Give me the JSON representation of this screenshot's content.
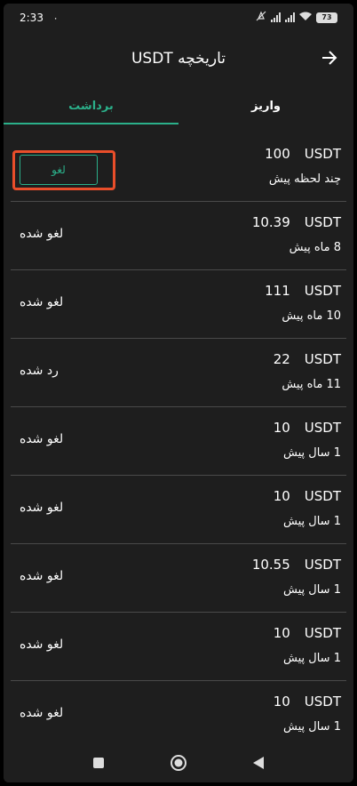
{
  "status_bar": {
    "time": "2:33",
    "small_icon": "vibrate-icon",
    "battery": "73"
  },
  "header": {
    "title": "تاریخچه  USDT",
    "back_icon": "arrow-right-icon"
  },
  "tabs": [
    {
      "label": "واریز",
      "active": false
    },
    {
      "label": "برداشت",
      "active": true
    }
  ],
  "colors": {
    "accent": "#2bb08a",
    "highlight": "#e94e2a",
    "background": "#1e1e1e",
    "divider": "#4a4a4a"
  },
  "rows": [
    {
      "value": "100",
      "currency": "USDT",
      "time": "چند لحظه پیش",
      "action_label": "لغو"
    },
    {
      "value": "10.39",
      "currency": "USDT",
      "time": "8 ماه پیش",
      "status": "لغو شده"
    },
    {
      "value": "111",
      "currency": "USDT",
      "time": "10 ماه پیش",
      "status": "لغو شده"
    },
    {
      "value": "22",
      "currency": "USDT",
      "time": "11 ماه پیش",
      "status": "رد شده"
    },
    {
      "value": "10",
      "currency": "USDT",
      "time": "1 سال پیش",
      "status": "لغو شده"
    },
    {
      "value": "10",
      "currency": "USDT",
      "time": "1 سال پیش",
      "status": "لغو شده"
    },
    {
      "value": "10.55",
      "currency": "USDT",
      "time": "1 سال پیش",
      "status": "لغو شده"
    },
    {
      "value": "10",
      "currency": "USDT",
      "time": "1 سال پیش",
      "status": "لغو شده"
    },
    {
      "value": "10",
      "currency": "USDT",
      "time": "1 سال پیش",
      "status": "لغو شده"
    }
  ],
  "nav_bar": {
    "icons": [
      "recents-square-icon",
      "home-circle-icon",
      "back-triangle-icon"
    ]
  }
}
